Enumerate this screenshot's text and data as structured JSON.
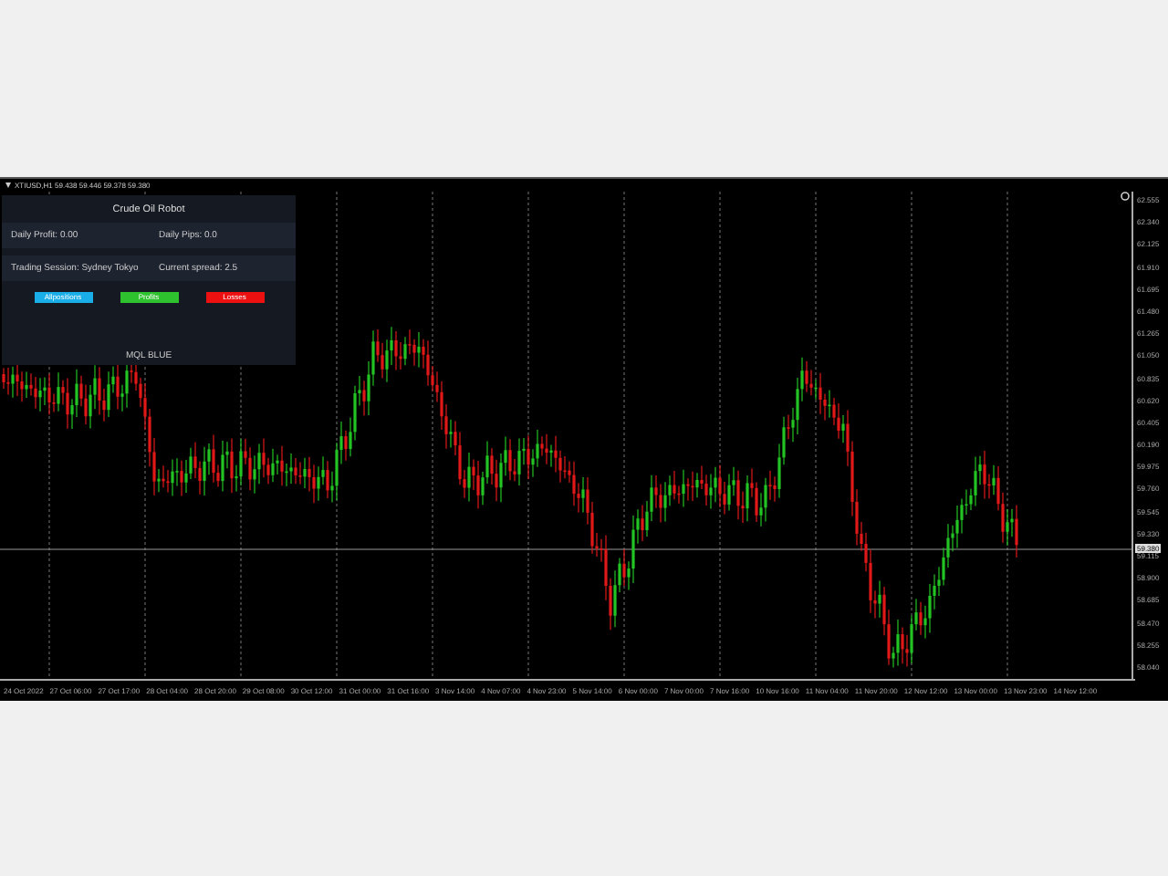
{
  "chart": {
    "header": "XTIUSD,H1  59.438 59.446 59.378 59.380",
    "price_labels": [
      "62.555",
      "62.340",
      "62.125",
      "61.910",
      "61.695",
      "61.480",
      "61.265",
      "61.050",
      "60.835",
      "60.620",
      "60.405",
      "60.190",
      "59.975",
      "59.760",
      "59.545",
      "59.330",
      "59.115",
      "58.900",
      "58.685",
      "58.470",
      "58.255",
      "58.040"
    ],
    "current_price": "59.380",
    "time_labels": [
      "24 Oct 2022",
      "27 Oct 06:00",
      "27 Oct 17:00",
      "28 Oct 04:00",
      "28 Oct 20:00",
      "29 Oct 08:00",
      "30 Oct 12:00",
      "31 Oct 00:00",
      "31 Oct 16:00",
      "3 Nov 14:00",
      "4 Nov 07:00",
      "4 Nov 23:00",
      "5 Nov 14:00",
      "6 Nov 00:00",
      "7 Nov 00:00",
      "7 Nov 16:00",
      "10 Nov 16:00",
      "11 Nov 04:00",
      "11 Nov 20:00",
      "12 Nov 12:00",
      "13 Nov 00:00",
      "13 Nov 23:00",
      "14 Nov 12:00"
    ]
  },
  "panel": {
    "title": "Crude Oil Robot",
    "rows": [
      [
        "Daily Profit: 0.00",
        "Daily Pips: 0.0"
      ],
      [
        "Trading Session: Sydney Tokyo",
        "Current spread: 2.5"
      ]
    ],
    "buttons": [
      {
        "label": "Allpositions",
        "color": "#19aee8"
      },
      {
        "label": "Profits",
        "color": "#2fc22f"
      },
      {
        "label": "Losses",
        "color": "#ec1010"
      }
    ],
    "footer": "MQL BLUE"
  }
}
